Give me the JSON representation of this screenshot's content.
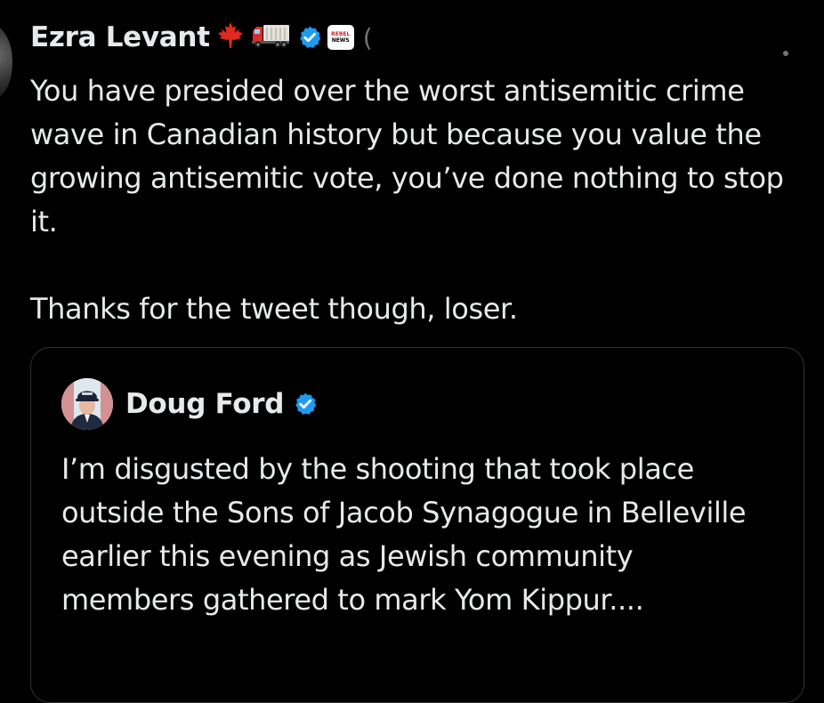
{
  "tweet": {
    "author_name": "Ezra Levant",
    "badge_emojis": [
      "🍁",
      "🚛"
    ],
    "verified_icon": "verified-badge-icon",
    "affiliate_badge": {
      "icon": "rebel-news-logo",
      "line1": "REBEL",
      "line2": "NEWS"
    },
    "handle_prefix": "(",
    "text": "You have presided over the worst antisemitic crime wave in Canadian history but because you value the growing antisemitic vote, you’ve done nothing to stop it.\n\nThanks for the tweet though, loser.",
    "menu_icon": "more-options-icon"
  },
  "quoted_tweet": {
    "author_name": "Doug Ford",
    "verified_icon": "verified-badge-icon",
    "avatar_icon": "profile-photo",
    "text": "I’m disgusted by the shooting that took place outside the Sons of Jacob Synagogue in Belleville earlier this evening as Jewish community members gathered to mark Yom Kippur...."
  },
  "colors": {
    "background": "#000000",
    "text": "#e7e9ea",
    "muted": "#71767b",
    "border": "#2f3336",
    "verified_blue": "#1d9bf0"
  }
}
